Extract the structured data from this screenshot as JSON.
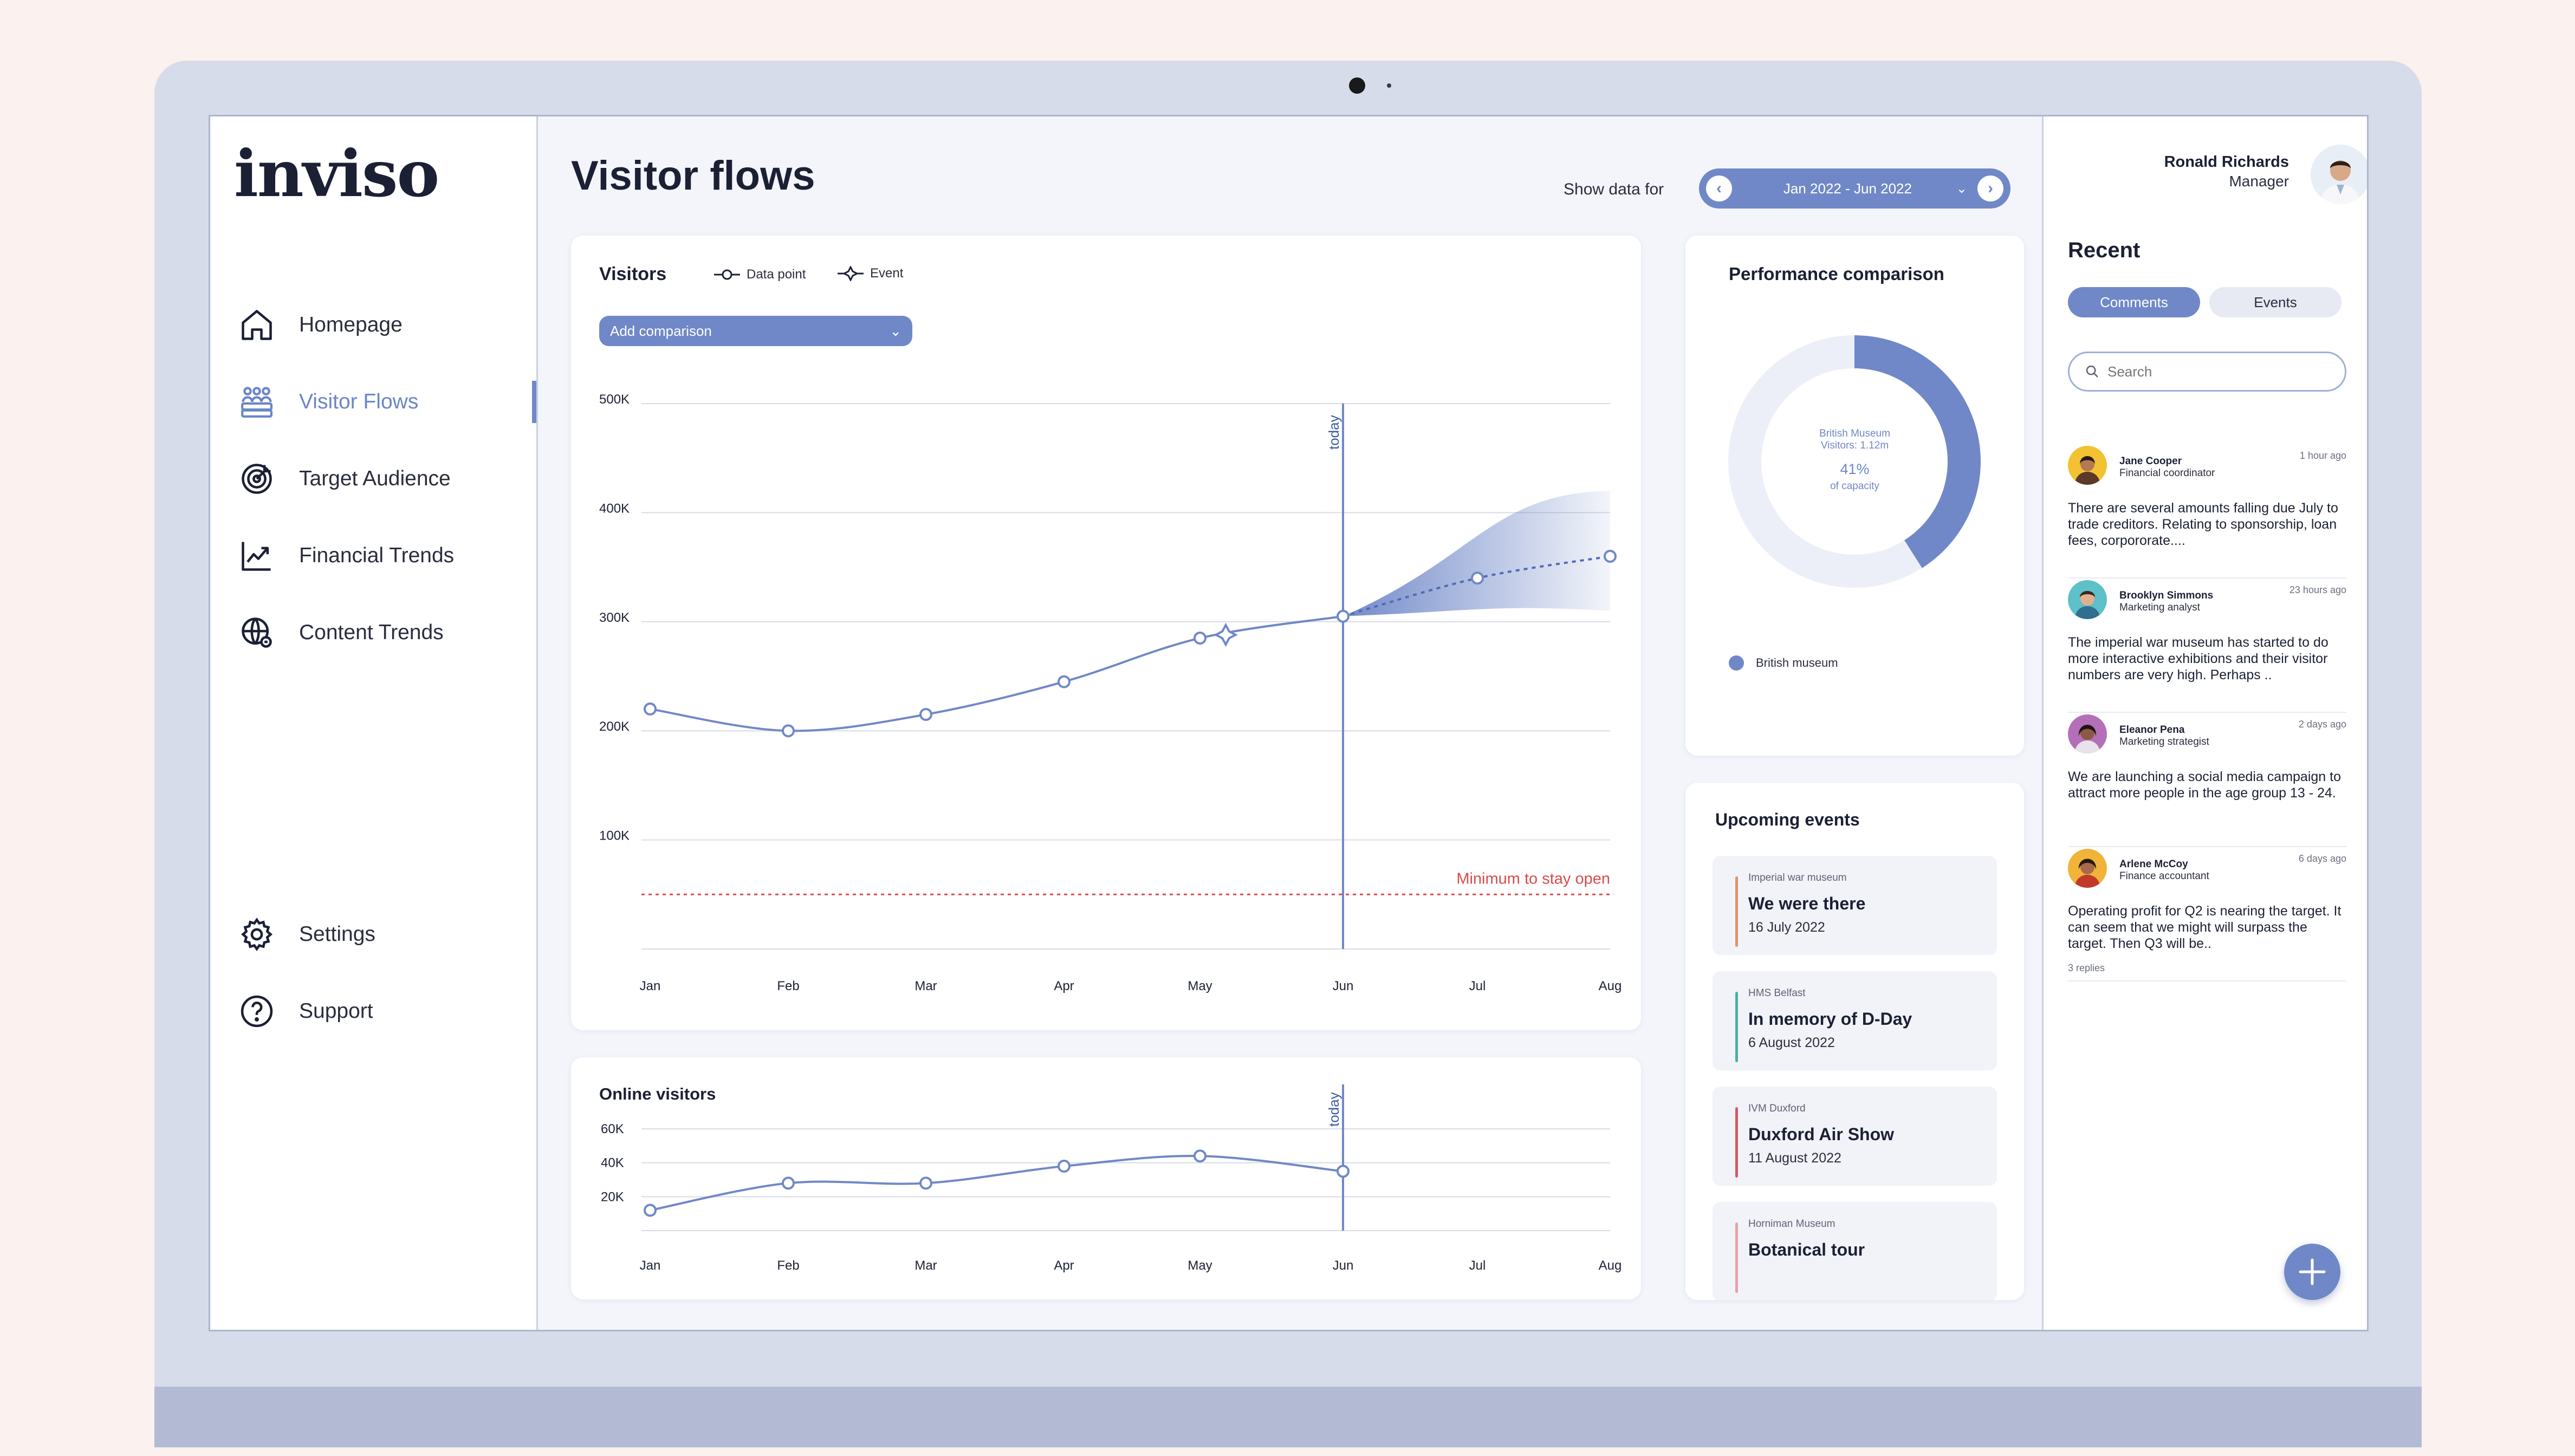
{
  "app": {
    "logo": "inviso"
  },
  "sidebar": {
    "items": [
      {
        "label": "Homepage",
        "icon": "home-icon"
      },
      {
        "label": "Visitor Flows",
        "icon": "people-icon",
        "active": true
      },
      {
        "label": "Target Audience",
        "icon": "target-icon"
      },
      {
        "label": "Financial Trends",
        "icon": "trend-chart-icon"
      },
      {
        "label": "Content Trends",
        "icon": "globe-icon"
      }
    ],
    "bottom_items": [
      {
        "label": "Settings",
        "icon": "gear-icon"
      },
      {
        "label": "Support",
        "icon": "question-icon"
      }
    ]
  },
  "header": {
    "title": "Visitor flows",
    "show_data_label": "Show data for",
    "date_range": "Jan 2022 - Jun 2022"
  },
  "visitors": {
    "title": "Visitors",
    "legend_data_point": "Data point",
    "legend_event": "Event",
    "add_comparison": "Add comparison",
    "today_label": "today",
    "min_label": "Minimum to stay open"
  },
  "online": {
    "title": "Online visitors",
    "today_label": "today"
  },
  "performance": {
    "title": "Performance comparison",
    "museum": "British Museum",
    "visitors": "Visitors: 1.12m",
    "percent": "41%",
    "capacity_label": "of capacity",
    "legend": "British museum"
  },
  "events": {
    "title": "Upcoming events",
    "items": [
      {
        "venue": "Imperial war museum",
        "name": "We were there",
        "date": "16 July 2022",
        "color": "#e0926a"
      },
      {
        "venue": "HMS Belfast",
        "name": "In memory of D-Day",
        "date": "6 August 2022",
        "color": "#4fae9e"
      },
      {
        "venue": "IVM Duxford",
        "name": "Duxford Air Show",
        "date": "11 August 2022",
        "color": "#d35866"
      },
      {
        "venue": "Horniman Museum",
        "name": "Botanical tour",
        "date": "",
        "color": "#e8a0aa"
      }
    ]
  },
  "user": {
    "name": "Ronald Richards",
    "role": "Manager"
  },
  "recent": {
    "title": "Recent",
    "tab_comments": "Comments",
    "tab_events": "Events",
    "search_placeholder": "Search",
    "comments": [
      {
        "name": "Jane Cooper",
        "role": "Financial coordinator",
        "time": "1 hour ago",
        "text": "There are several amounts falling due July to trade creditors. Relating to sponsorship, loan fees, corpororate....",
        "replies": ""
      },
      {
        "name": "Brooklyn Simmons",
        "role": "Marketing analyst",
        "time": "23 hours ago",
        "text": "The imperial war museum has started to do more interactive exhibitions and their visitor numbers are very high. Perhaps ..",
        "replies": ""
      },
      {
        "name": "Eleanor Pena",
        "role": "Marketing strategist",
        "time": "2 days ago",
        "text": "We are launching a social media campaign to attract more people in the age group 13 - 24.",
        "replies": ""
      },
      {
        "name": "Arlene McCoy",
        "role": "Finance accountant",
        "time": "6 days ago",
        "text": "Operating profit for Q2 is nearing the target. It can seem that we might will surpass the target. Then Q3 will be..",
        "replies": "3 replies"
      }
    ]
  },
  "chart_data": [
    {
      "type": "line",
      "title": "Visitors",
      "categories": [
        "Jan",
        "Feb",
        "Mar",
        "Apr",
        "May",
        "Jun",
        "Jul",
        "Aug"
      ],
      "yticks": [
        "500K",
        "400K",
        "300K",
        "200K",
        "100K"
      ],
      "ylim": [
        0,
        500000
      ],
      "series": [
        {
          "name": "Data point",
          "x": [
            0,
            1,
            2,
            3,
            4,
            5
          ],
          "values": [
            220000,
            200000,
            215000,
            245000,
            285000,
            305000
          ]
        },
        {
          "name": "forecast",
          "x": [
            5,
            6,
            7
          ],
          "values": [
            305000,
            340000,
            360000
          ]
        }
      ],
      "events": [
        {
          "x": 4.18,
          "value": 288000
        }
      ],
      "today_x": 5,
      "minimum_line": 50000,
      "forecast_band": {
        "upper_at_aug": 420000,
        "lower_at_aug": 310000
      }
    },
    {
      "type": "line",
      "title": "Online visitors",
      "categories": [
        "Jan",
        "Feb",
        "Mar",
        "Apr",
        "May",
        "Jun",
        "Jul",
        "Aug"
      ],
      "yticks": [
        "60K",
        "40K",
        "20K"
      ],
      "ylim": [
        0,
        60000
      ],
      "series": [
        {
          "name": "Online visitors",
          "x": [
            0,
            1,
            2,
            3,
            4,
            5
          ],
          "values": [
            12000,
            28000,
            28000,
            38000,
            44000,
            35000
          ]
        }
      ],
      "today_x": 5
    },
    {
      "type": "pie",
      "title": "Performance comparison",
      "categories": [
        "British museum",
        "remaining"
      ],
      "values": [
        41,
        59
      ]
    }
  ]
}
